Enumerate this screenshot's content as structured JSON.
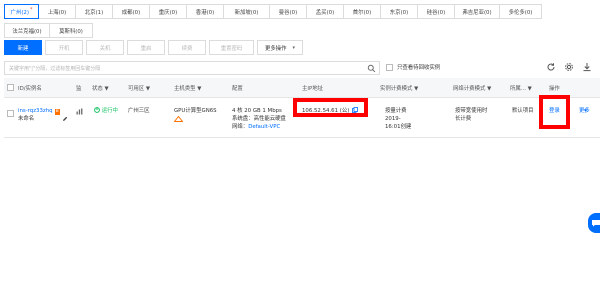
{
  "regions": {
    "row1": [
      {
        "label": "广州(2)",
        "active": true,
        "dot": "*"
      },
      {
        "label": "上海(0)"
      },
      {
        "label": "北京(1)"
      },
      {
        "label": "成都(0)"
      },
      {
        "label": "重庆(0)"
      },
      {
        "label": "香港(0)"
      },
      {
        "label": "新加坡(0)"
      },
      {
        "label": "曼谷(0)"
      },
      {
        "label": "孟买(0)"
      },
      {
        "label": "首尔(0)"
      },
      {
        "label": "东京(0)"
      },
      {
        "label": "硅谷(0)"
      },
      {
        "label": "弗吉尼亚(0)"
      },
      {
        "label": "多伦多(0)"
      }
    ],
    "row2": [
      {
        "label": "法兰克福(0)"
      },
      {
        "label": "莫斯科(0)"
      }
    ]
  },
  "toolbar": {
    "new_label": "新建",
    "start_label": "开机",
    "shutdown_label": "关机",
    "restart_label": "重启",
    "renew_label": "续费",
    "reset_password_label": "重置密码",
    "more_label": "更多操作"
  },
  "search": {
    "placeholder": "关键字用\"|\"分隔，过滤标签用回车键分隔"
  },
  "recycle_filter_label": "只查看待回收实例",
  "table": {
    "headers": {
      "id_name": "ID/实例名",
      "monitor": "监",
      "status": "状态",
      "zone": "可用区",
      "host_type": "主机类型",
      "config": "配置",
      "ip": "主IP地址",
      "billing": "实例计费模式",
      "net_billing": "网络计费模式",
      "project": "所属...",
      "ops": "操作"
    },
    "rows": [
      {
        "id": "ins-rqz33zhq",
        "id_badge": "B",
        "name": "未命名",
        "status": "运行中",
        "zone": "广州三区",
        "host_type": "GPU计算型GN6S",
        "config_line1": "4 核 20 GB 1 Mbps",
        "config_line2": "系统盘：高性能云硬盘",
        "config_network_label": "网络：",
        "config_network": "Default-VPC",
        "ip": "106.52.54.61 (公)",
        "billing_line1": "按量计费",
        "billing_line2": "2019-",
        "billing_line3": "16:01创建",
        "net_billing_line1": "按带宽使用时",
        "net_billing_line2": "长计费",
        "project": "默认项目",
        "login_label": "登录",
        "more_ops_label": "更多"
      }
    ]
  },
  "colors": {
    "accent": "#006eff",
    "highlight_border": "#ff0000",
    "running": "#0abf5b",
    "badge": "#ff7200"
  }
}
